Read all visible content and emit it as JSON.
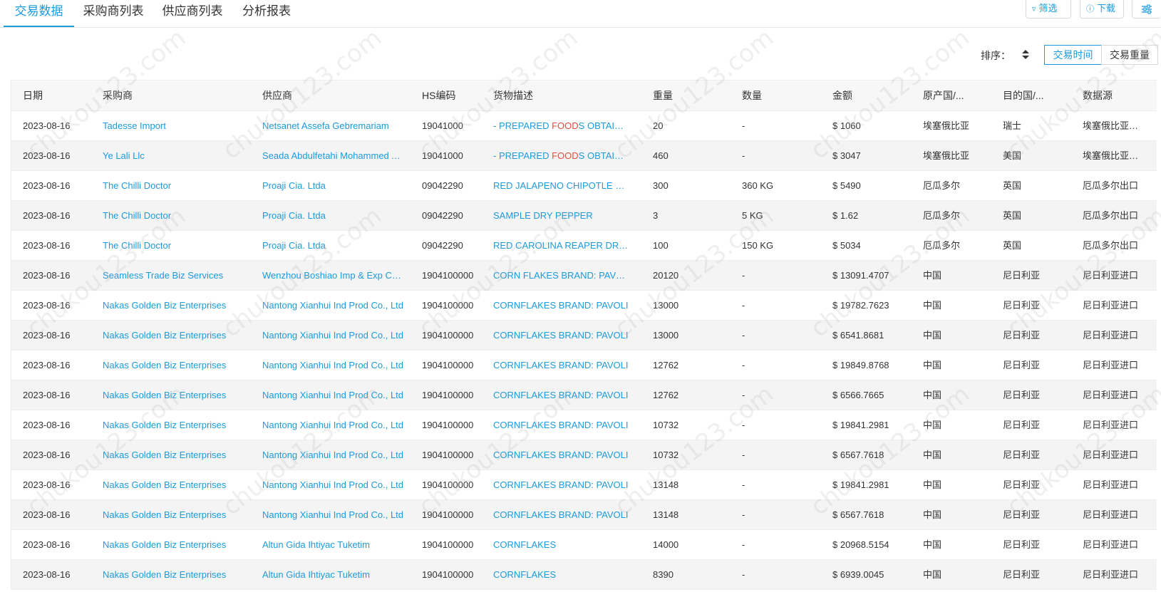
{
  "tabs": [
    {
      "label": "交易数据",
      "active": true
    },
    {
      "label": "采购商列表",
      "active": false
    },
    {
      "label": "供应商列表",
      "active": false
    },
    {
      "label": "分析报表",
      "active": false
    }
  ],
  "toolbar": {
    "filter_label": "筛选",
    "download_label": "下载",
    "settings_icon": "sliders-icon"
  },
  "sort": {
    "label": "排序：",
    "options": [
      {
        "label": "交易时间",
        "active": true
      },
      {
        "label": "交易重量",
        "active": false
      }
    ]
  },
  "watermark": "chukou123.com",
  "columns": [
    "日期",
    "采购商",
    "供应商",
    "HS编码",
    "货物描述",
    "重量",
    "数量",
    "金额",
    "原产国/...",
    "目的国/...",
    "数据源"
  ],
  "rows": [
    {
      "date": "2023-08-16",
      "buyer": "Tadesse Import",
      "supplier": "Netsanet Assefa Gebremariam",
      "hs": "19041000",
      "desc_pre": "- PREPARED ",
      "desc_hl": "FOOD",
      "desc_post": "S OBTAINED BY THE SWELLING OR ROASTING",
      "weight": "20",
      "qty": "-",
      "amount": "$ 1060",
      "origin": "埃塞俄比亚",
      "dest": "瑞士",
      "source": "埃塞俄比亚出口"
    },
    {
      "date": "2023-08-16",
      "buyer": "Ye Lali Llc",
      "supplier": "Seada Abdulfetahi Mohammed Ahmed",
      "hs": "19041000",
      "desc_pre": "- PREPARED ",
      "desc_hl": "FOOD",
      "desc_post": "S OBTAINED BY THE SWELLING OR ROASTING",
      "weight": "460",
      "qty": "-",
      "amount": "$ 3047",
      "origin": "埃塞俄比亚",
      "dest": "美国",
      "source": "埃塞俄比亚出口"
    },
    {
      "date": "2023-08-16",
      "buyer": "The Chilli Doctor",
      "supplier": "Proaji Cia. Ltda",
      "hs": "09042290",
      "desc_pre": "RED JALAPENO CHIPOTLE DRY PEPPER",
      "desc_hl": "",
      "desc_post": "",
      "weight": "300",
      "qty": "360 KG",
      "amount": "$ 5490",
      "origin": "厄瓜多尔",
      "dest": "英国",
      "source": "厄瓜多尔出口"
    },
    {
      "date": "2023-08-16",
      "buyer": "The Chilli Doctor",
      "supplier": "Proaji Cia. Ltda",
      "hs": "09042290",
      "desc_pre": "SAMPLE DRY PEPPER",
      "desc_hl": "",
      "desc_post": "",
      "weight": "3",
      "qty": "5 KG",
      "amount": "$ 1.62",
      "origin": "厄瓜多尔",
      "dest": "英国",
      "source": "厄瓜多尔出口"
    },
    {
      "date": "2023-08-16",
      "buyer": "The Chilli Doctor",
      "supplier": "Proaji Cia. Ltda",
      "hs": "09042290",
      "desc_pre": "RED CAROLINA REAPER DRY PEPPER",
      "desc_hl": "",
      "desc_post": "",
      "weight": "100",
      "qty": "150 KG",
      "amount": "$ 5034",
      "origin": "厄瓜多尔",
      "dest": "英国",
      "source": "厄瓜多尔出口"
    },
    {
      "date": "2023-08-16",
      "buyer": "Seamless Trade Biz Services",
      "supplier": "Wenzhou Boshiao Imp & Exp Co., Ltd",
      "hs": "1904100000",
      "desc_pre": "CORN FLAKES BRAND: PAVOLI",
      "desc_hl": "",
      "desc_post": "",
      "weight": "20120",
      "qty": "-",
      "amount": "$ 13091.4707",
      "origin": "中国",
      "dest": "尼日利亚",
      "source": "尼日利亚进口"
    },
    {
      "date": "2023-08-16",
      "buyer": "Nakas Golden Biz Enterprises",
      "supplier": "Nantong Xianhui Ind Prod Co., Ltd",
      "hs": "1904100000",
      "desc_pre": "CORNFLAKES BRAND: PAVOLI",
      "desc_hl": "",
      "desc_post": "",
      "weight": "13000",
      "qty": "-",
      "amount": "$ 19782.7623",
      "origin": "中国",
      "dest": "尼日利亚",
      "source": "尼日利亚进口"
    },
    {
      "date": "2023-08-16",
      "buyer": "Nakas Golden Biz Enterprises",
      "supplier": "Nantong Xianhui Ind Prod Co., Ltd",
      "hs": "1904100000",
      "desc_pre": "CORNFLAKES BRAND: PAVOLI",
      "desc_hl": "",
      "desc_post": "",
      "weight": "13000",
      "qty": "-",
      "amount": "$ 6541.8681",
      "origin": "中国",
      "dest": "尼日利亚",
      "source": "尼日利亚进口"
    },
    {
      "date": "2023-08-16",
      "buyer": "Nakas Golden Biz Enterprises",
      "supplier": "Nantong Xianhui Ind Prod Co., Ltd",
      "hs": "1904100000",
      "desc_pre": "CORNFLAKES BRAND: PAVOLI",
      "desc_hl": "",
      "desc_post": "",
      "weight": "12762",
      "qty": "-",
      "amount": "$ 19849.8768",
      "origin": "中国",
      "dest": "尼日利亚",
      "source": "尼日利亚进口"
    },
    {
      "date": "2023-08-16",
      "buyer": "Nakas Golden Biz Enterprises",
      "supplier": "Nantong Xianhui Ind Prod Co., Ltd",
      "hs": "1904100000",
      "desc_pre": "CORNFLAKES BRAND: PAVOLI",
      "desc_hl": "",
      "desc_post": "",
      "weight": "12762",
      "qty": "-",
      "amount": "$ 6566.7665",
      "origin": "中国",
      "dest": "尼日利亚",
      "source": "尼日利亚进口"
    },
    {
      "date": "2023-08-16",
      "buyer": "Nakas Golden Biz Enterprises",
      "supplier": "Nantong Xianhui Ind Prod Co., Ltd",
      "hs": "1904100000",
      "desc_pre": "CORNFLAKES BRAND: PAVOLI",
      "desc_hl": "",
      "desc_post": "",
      "weight": "10732",
      "qty": "-",
      "amount": "$ 19841.2981",
      "origin": "中国",
      "dest": "尼日利亚",
      "source": "尼日利亚进口"
    },
    {
      "date": "2023-08-16",
      "buyer": "Nakas Golden Biz Enterprises",
      "supplier": "Nantong Xianhui Ind Prod Co., Ltd",
      "hs": "1904100000",
      "desc_pre": "CORNFLAKES BRAND: PAVOLI",
      "desc_hl": "",
      "desc_post": "",
      "weight": "10732",
      "qty": "-",
      "amount": "$ 6567.7618",
      "origin": "中国",
      "dest": "尼日利亚",
      "source": "尼日利亚进口"
    },
    {
      "date": "2023-08-16",
      "buyer": "Nakas Golden Biz Enterprises",
      "supplier": "Nantong Xianhui Ind Prod Co., Ltd",
      "hs": "1904100000",
      "desc_pre": "CORNFLAKES BRAND: PAVOLI",
      "desc_hl": "",
      "desc_post": "",
      "weight": "13148",
      "qty": "-",
      "amount": "$ 19841.2981",
      "origin": "中国",
      "dest": "尼日利亚",
      "source": "尼日利亚进口"
    },
    {
      "date": "2023-08-16",
      "buyer": "Nakas Golden Biz Enterprises",
      "supplier": "Nantong Xianhui Ind Prod Co., Ltd",
      "hs": "1904100000",
      "desc_pre": "CORNFLAKES BRAND: PAVOLI",
      "desc_hl": "",
      "desc_post": "",
      "weight": "13148",
      "qty": "-",
      "amount": "$ 6567.7618",
      "origin": "中国",
      "dest": "尼日利亚",
      "source": "尼日利亚进口"
    },
    {
      "date": "2023-08-16",
      "buyer": "Nakas Golden Biz Enterprises",
      "supplier": "Altun Gida Ihtiyac Tuketim",
      "hs": "1904100000",
      "desc_pre": "CORNFLAKES",
      "desc_hl": "",
      "desc_post": "",
      "weight": "14000",
      "qty": "-",
      "amount": "$ 20968.5154",
      "origin": "中国",
      "dest": "尼日利亚",
      "source": "尼日利亚进口"
    },
    {
      "date": "2023-08-16",
      "buyer": "Nakas Golden Biz Enterprises",
      "supplier": "Altun Gida Ihtiyac Tuketim",
      "hs": "1904100000",
      "desc_pre": "CORNFLAKES",
      "desc_hl": "",
      "desc_post": "",
      "weight": "8390",
      "qty": "-",
      "amount": "$ 6939.0045",
      "origin": "中国",
      "dest": "尼日利亚",
      "source": "尼日利亚进口"
    }
  ]
}
